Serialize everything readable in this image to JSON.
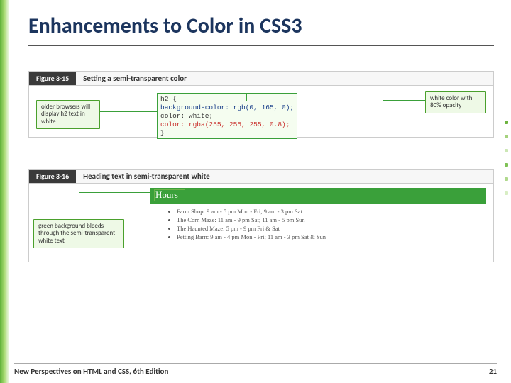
{
  "title": "Enhancements to Color in CSS3",
  "decor_dot_colors": [
    "#6db33f",
    "#a5d27e",
    "#cce7b5",
    "#7fc256",
    "#b0d98d",
    "#d8eec4",
    "#6db33f",
    "#9ed078"
  ],
  "figure1": {
    "badge": "Figure 3-15",
    "title": "Setting a semi-transparent color",
    "callout_left": "older browsers will display h2 text in white",
    "callout_right": "white color with 80% opacity",
    "code_line1": "h2 {",
    "code_line2": "   background-color: rgb(0, 165, 0);",
    "code_line3": "   color: white;",
    "code_line4": "   color: rgba(255, 255, 255, 0.8);",
    "code_line5": "}"
  },
  "figure2": {
    "badge": "Figure 3-16",
    "title": "Heading text in semi-transparent white",
    "hours_heading": "Hours",
    "callout_left": "green background bleeds through the semi-transparent white text",
    "items": {
      "i0": "Farm Shop: 9 am - 5 pm Mon - Fri; 9 am - 3 pm Sat",
      "i1": "The Corn Maze: 11 am - 9 pm Sat; 11 am - 5 pm Sun",
      "i2": "The Haunted Maze: 5 pm - 9 pm Fri & Sat",
      "i3": "Petting Barn: 9 am - 4 pm Mon - Fri; 11 am - 3 pm Sat & Sun"
    }
  },
  "footer": {
    "left": "New Perspectives on HTML and CSS, 6th Edition",
    "right": "21"
  }
}
